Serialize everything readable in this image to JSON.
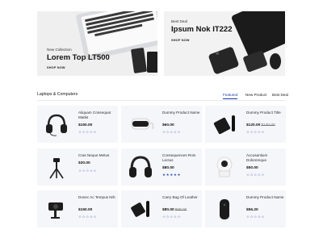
{
  "banners": {
    "left": {
      "eyebrow": "New Collection",
      "title": "Lorem Top LT500",
      "cta": "SHOP NOW"
    },
    "right": {
      "eyebrow": "Best Deal",
      "title": "Ipsum Nok IT222",
      "cta": "SHOP NOW"
    }
  },
  "section": {
    "title": "Laptops & Computers",
    "tabs": [
      {
        "label": "Featured",
        "active": true
      },
      {
        "label": "New Product",
        "active": false
      },
      {
        "label": "Best Deal",
        "active": false
      }
    ]
  },
  "products": [
    {
      "name": "Aliquam Consequat Mattis",
      "price": "$150.00",
      "old_price": "",
      "rating": 0,
      "icon": "headset-icon"
    },
    {
      "name": "Dummy Product Name",
      "price": "$60.00",
      "old_price": "",
      "rating": 0,
      "icon": "vr-headset-icon"
    },
    {
      "name": "Dummy Product Title",
      "price": "$120.00",
      "old_price": "$130.00",
      "rating": 0,
      "icon": "streaming-box-icon"
    },
    {
      "name": "Cras Neque Metus",
      "price": "$30.00",
      "old_price": "",
      "rating": 0,
      "icon": "tripod-icon"
    },
    {
      "name": "Consequences Roin Lectus",
      "price": "$80.00",
      "old_price": "",
      "rating": 5,
      "icon": "headphones-icon"
    },
    {
      "name": "Accusantium Doloremque",
      "price": "$50.00",
      "old_price": "",
      "rating": 0,
      "icon": "security-camera-icon"
    },
    {
      "name": "Donec Ac Tempus Nrb",
      "price": "$150.00",
      "old_price": "",
      "rating": 0,
      "icon": "webcam-icon"
    },
    {
      "name": "Carry Bag Of Leather",
      "price": "$80.00",
      "old_price": "$88.00",
      "rating": 0,
      "icon": "remote-icon"
    },
    {
      "name": "Dummy Product Name",
      "price": "$56.20",
      "old_price": "",
      "rating": 0,
      "icon": "speaker-icon"
    }
  ]
}
